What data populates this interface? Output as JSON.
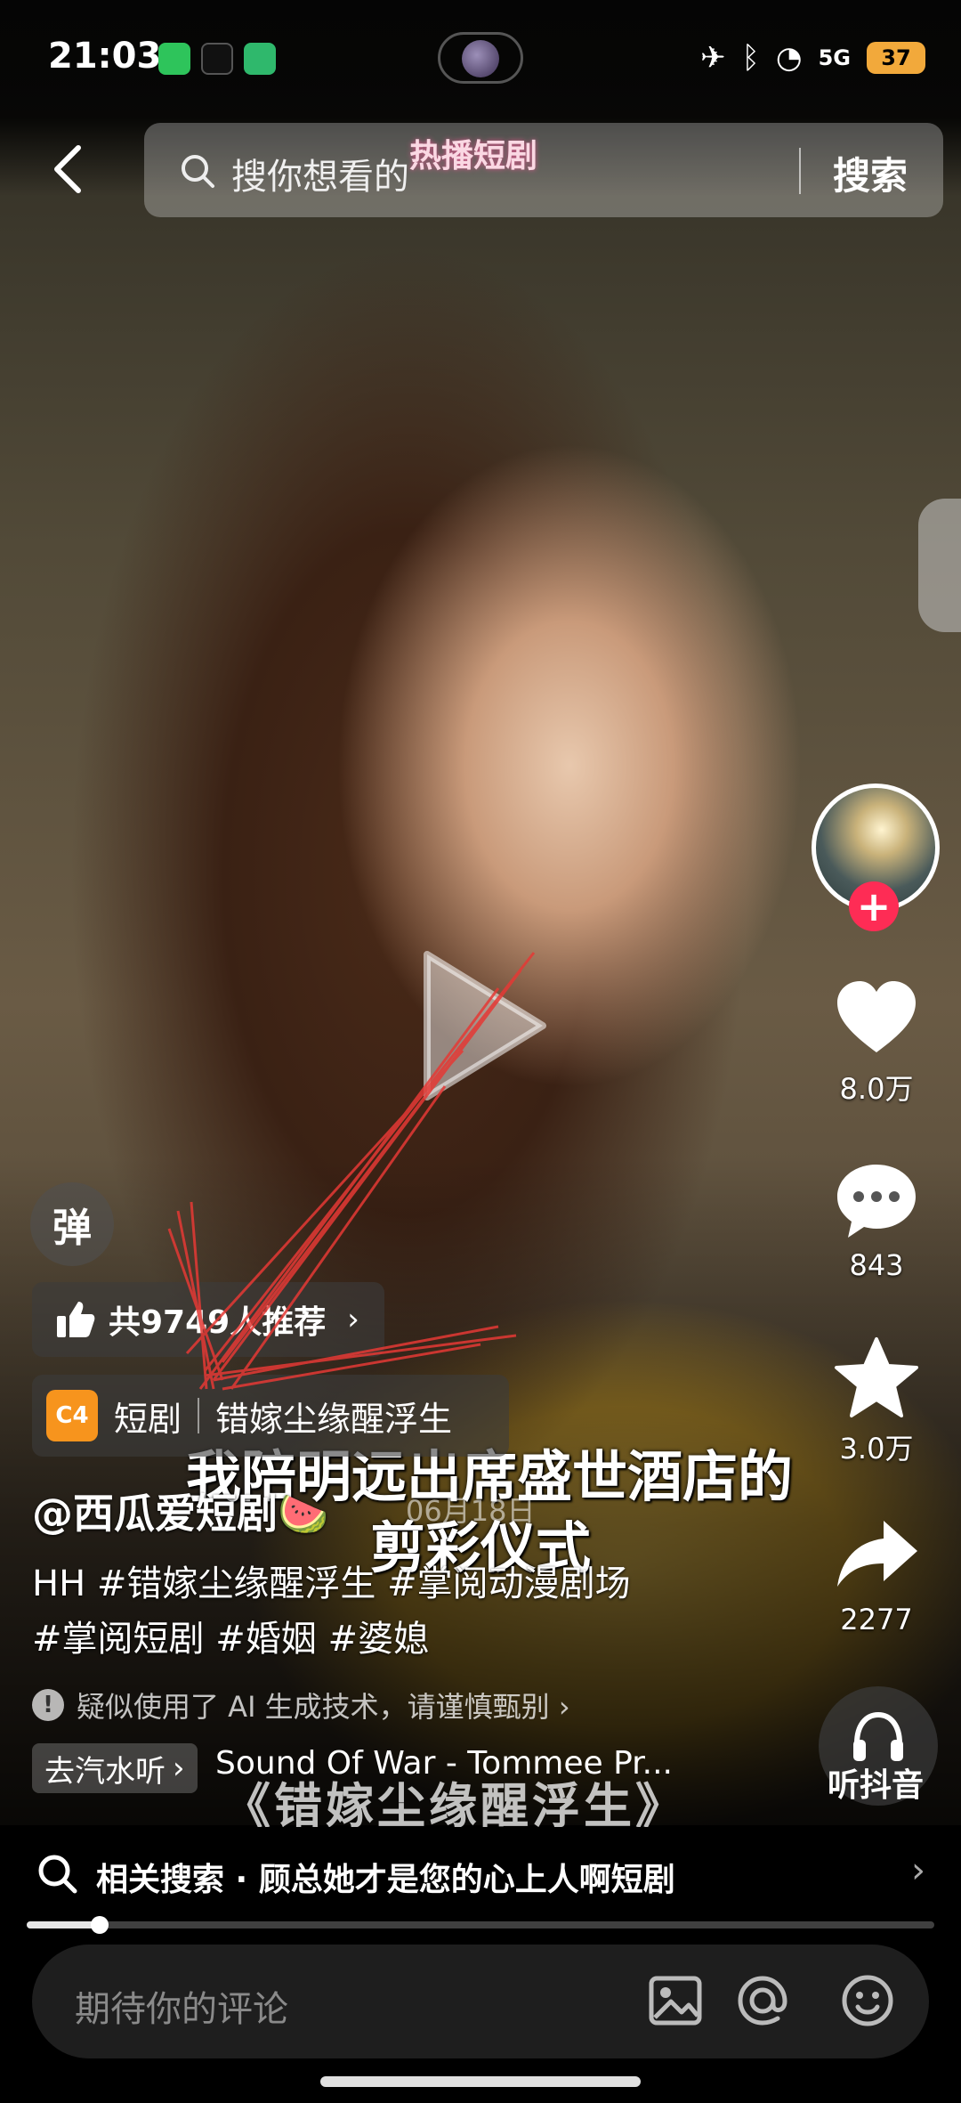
{
  "status_bar": {
    "time": "21:03",
    "battery": "37",
    "network": "5G"
  },
  "search": {
    "placeholder": "搜你想看的",
    "button": "搜索",
    "banner": "热播短剧"
  },
  "video": {
    "subtitle_line1": "我陪明远出席盛世酒店的",
    "subtitle_line2": "剪彩仪式",
    "timestamp": "06月18日",
    "title_overlay": "《错嫁尘缘醒浮生》"
  },
  "rail": {
    "likes": "8.0万",
    "comments": "843",
    "favorites": "3.0万",
    "shares": "2277",
    "music_label": "听抖音"
  },
  "danmaku_label": "弹",
  "recommend": {
    "text": "共9749人推荐"
  },
  "drama": {
    "label": "短剧",
    "name": "错嫁尘缘醒浮生"
  },
  "caption": {
    "author": "@西瓜爱短剧🍉",
    "line1": "HH #错嫁尘缘醒浮生 #掌阅动漫剧场",
    "line2": "#掌阅短剧 #婚姻 #婆媳",
    "ai_notice": "疑似使用了 AI 生成技术，请谨慎甄别 ›"
  },
  "music": {
    "tag": "去汽水听",
    "title": "Sound Of War - Tommee Pr..."
  },
  "related": {
    "label": "相关搜索 · 顾总她才是您的心上人啊短剧"
  },
  "progress": {
    "fraction": 0.08
  },
  "comment": {
    "placeholder": "期待你的评论"
  },
  "colors": {
    "follow": "#fe2c55",
    "drama_logo": "#f7941d",
    "battery": "#f2a93b"
  }
}
